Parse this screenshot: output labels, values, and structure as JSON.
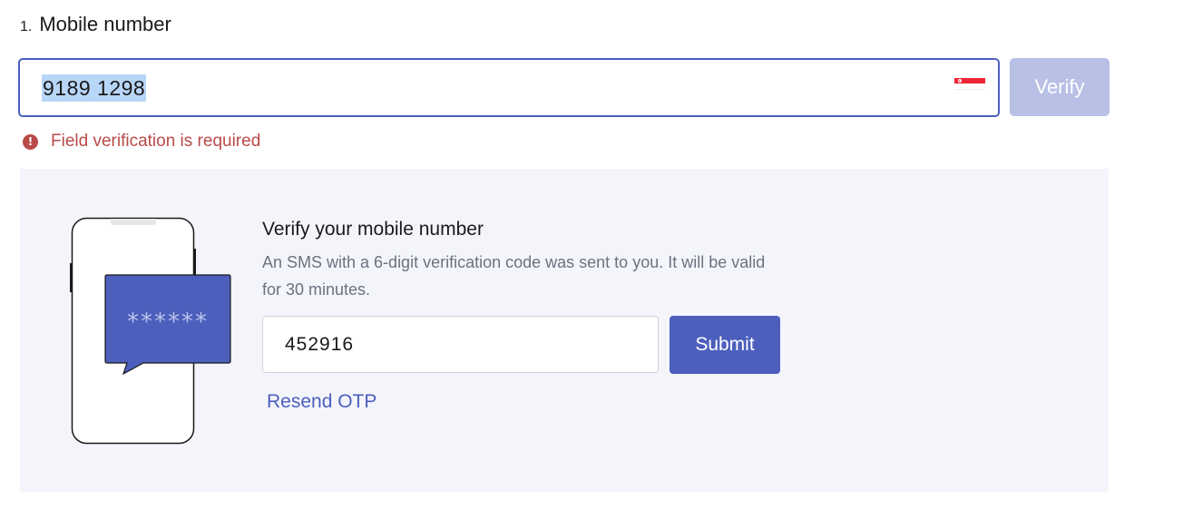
{
  "question": {
    "number": "1.",
    "title": "Mobile number"
  },
  "phone_field": {
    "value": "9189 1298",
    "country_flag": "singapore-flag-icon"
  },
  "verify_button": {
    "label": "Verify",
    "disabled": true
  },
  "error": {
    "icon": "exclamation-circle-icon",
    "message": "Field verification is required"
  },
  "otp": {
    "title": "Verify your mobile number",
    "description": "An SMS with a 6-digit verification code was sent to you. It will be valid for 30 minutes.",
    "code_value": "452916",
    "submit_label": "Submit",
    "resend_label": "Resend OTP",
    "illustration_masked_code": "******"
  },
  "colors": {
    "primary": "#4c5fbd",
    "primary_disabled": "#b9c0e6",
    "error": "#b94a48",
    "panel_bg": "#f4f5fb",
    "text_muted": "#6b7280"
  }
}
